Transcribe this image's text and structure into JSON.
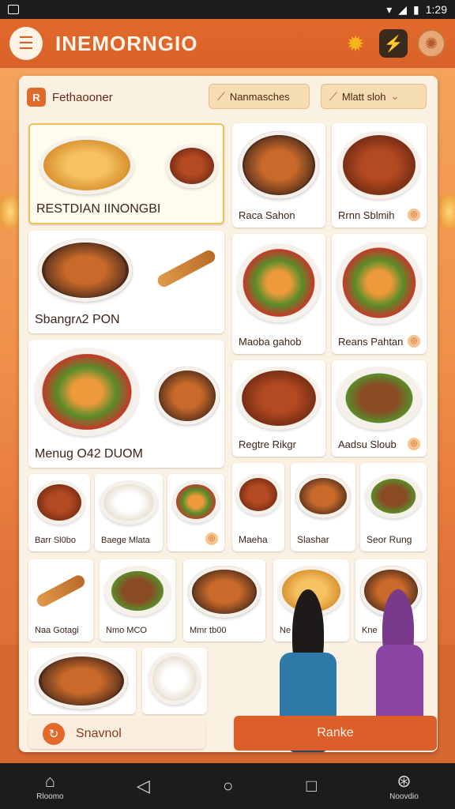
{
  "status_bar": {
    "time": "1:29"
  },
  "header": {
    "title": "INEMORNGIO",
    "icons": [
      "search-badge-icon",
      "flash-icon",
      "settings-icon"
    ]
  },
  "panel": {
    "restaurant_label": "Fethaooner",
    "restaurant_icon_glyph": "R",
    "filter_1": "Nanmasches",
    "filter_2": "Mlatt sloh"
  },
  "menu": [
    {
      "label": "RESTDIAN IINONGBI"
    },
    {
      "label": "Raca Sahon"
    },
    {
      "label": "Rrnn Sblmih"
    },
    {
      "label": "Sbangrᴧ2 PON"
    },
    {
      "label": "Maoba gahob"
    },
    {
      "label": "Reans Pahtan"
    },
    {
      "label": "Menug O42 DUOM"
    },
    {
      "label": "Regtre Rikgr"
    },
    {
      "label": "Aadsu Sloub"
    },
    {
      "label": "Barr Sl0bo"
    },
    {
      "label": "Baege Mlata"
    },
    {
      "label": "Maeha"
    },
    {
      "label": "Slashar"
    },
    {
      "label": "Seor Rung"
    },
    {
      "label": "Naa Gotagi"
    },
    {
      "label": "Nmo MCO"
    },
    {
      "label": "Mmr tb00"
    },
    {
      "label": "Ne"
    },
    {
      "label": "Kne"
    }
  ],
  "actions": {
    "scroll_label": "Snavnol",
    "rank_label": "Ranke"
  },
  "nav": {
    "home_label": "Rloomo",
    "assistant_label": "Noovdio"
  },
  "colors": {
    "accent": "#dc5f2a",
    "panel": "#fbf1e3",
    "header": "#e2692a"
  }
}
